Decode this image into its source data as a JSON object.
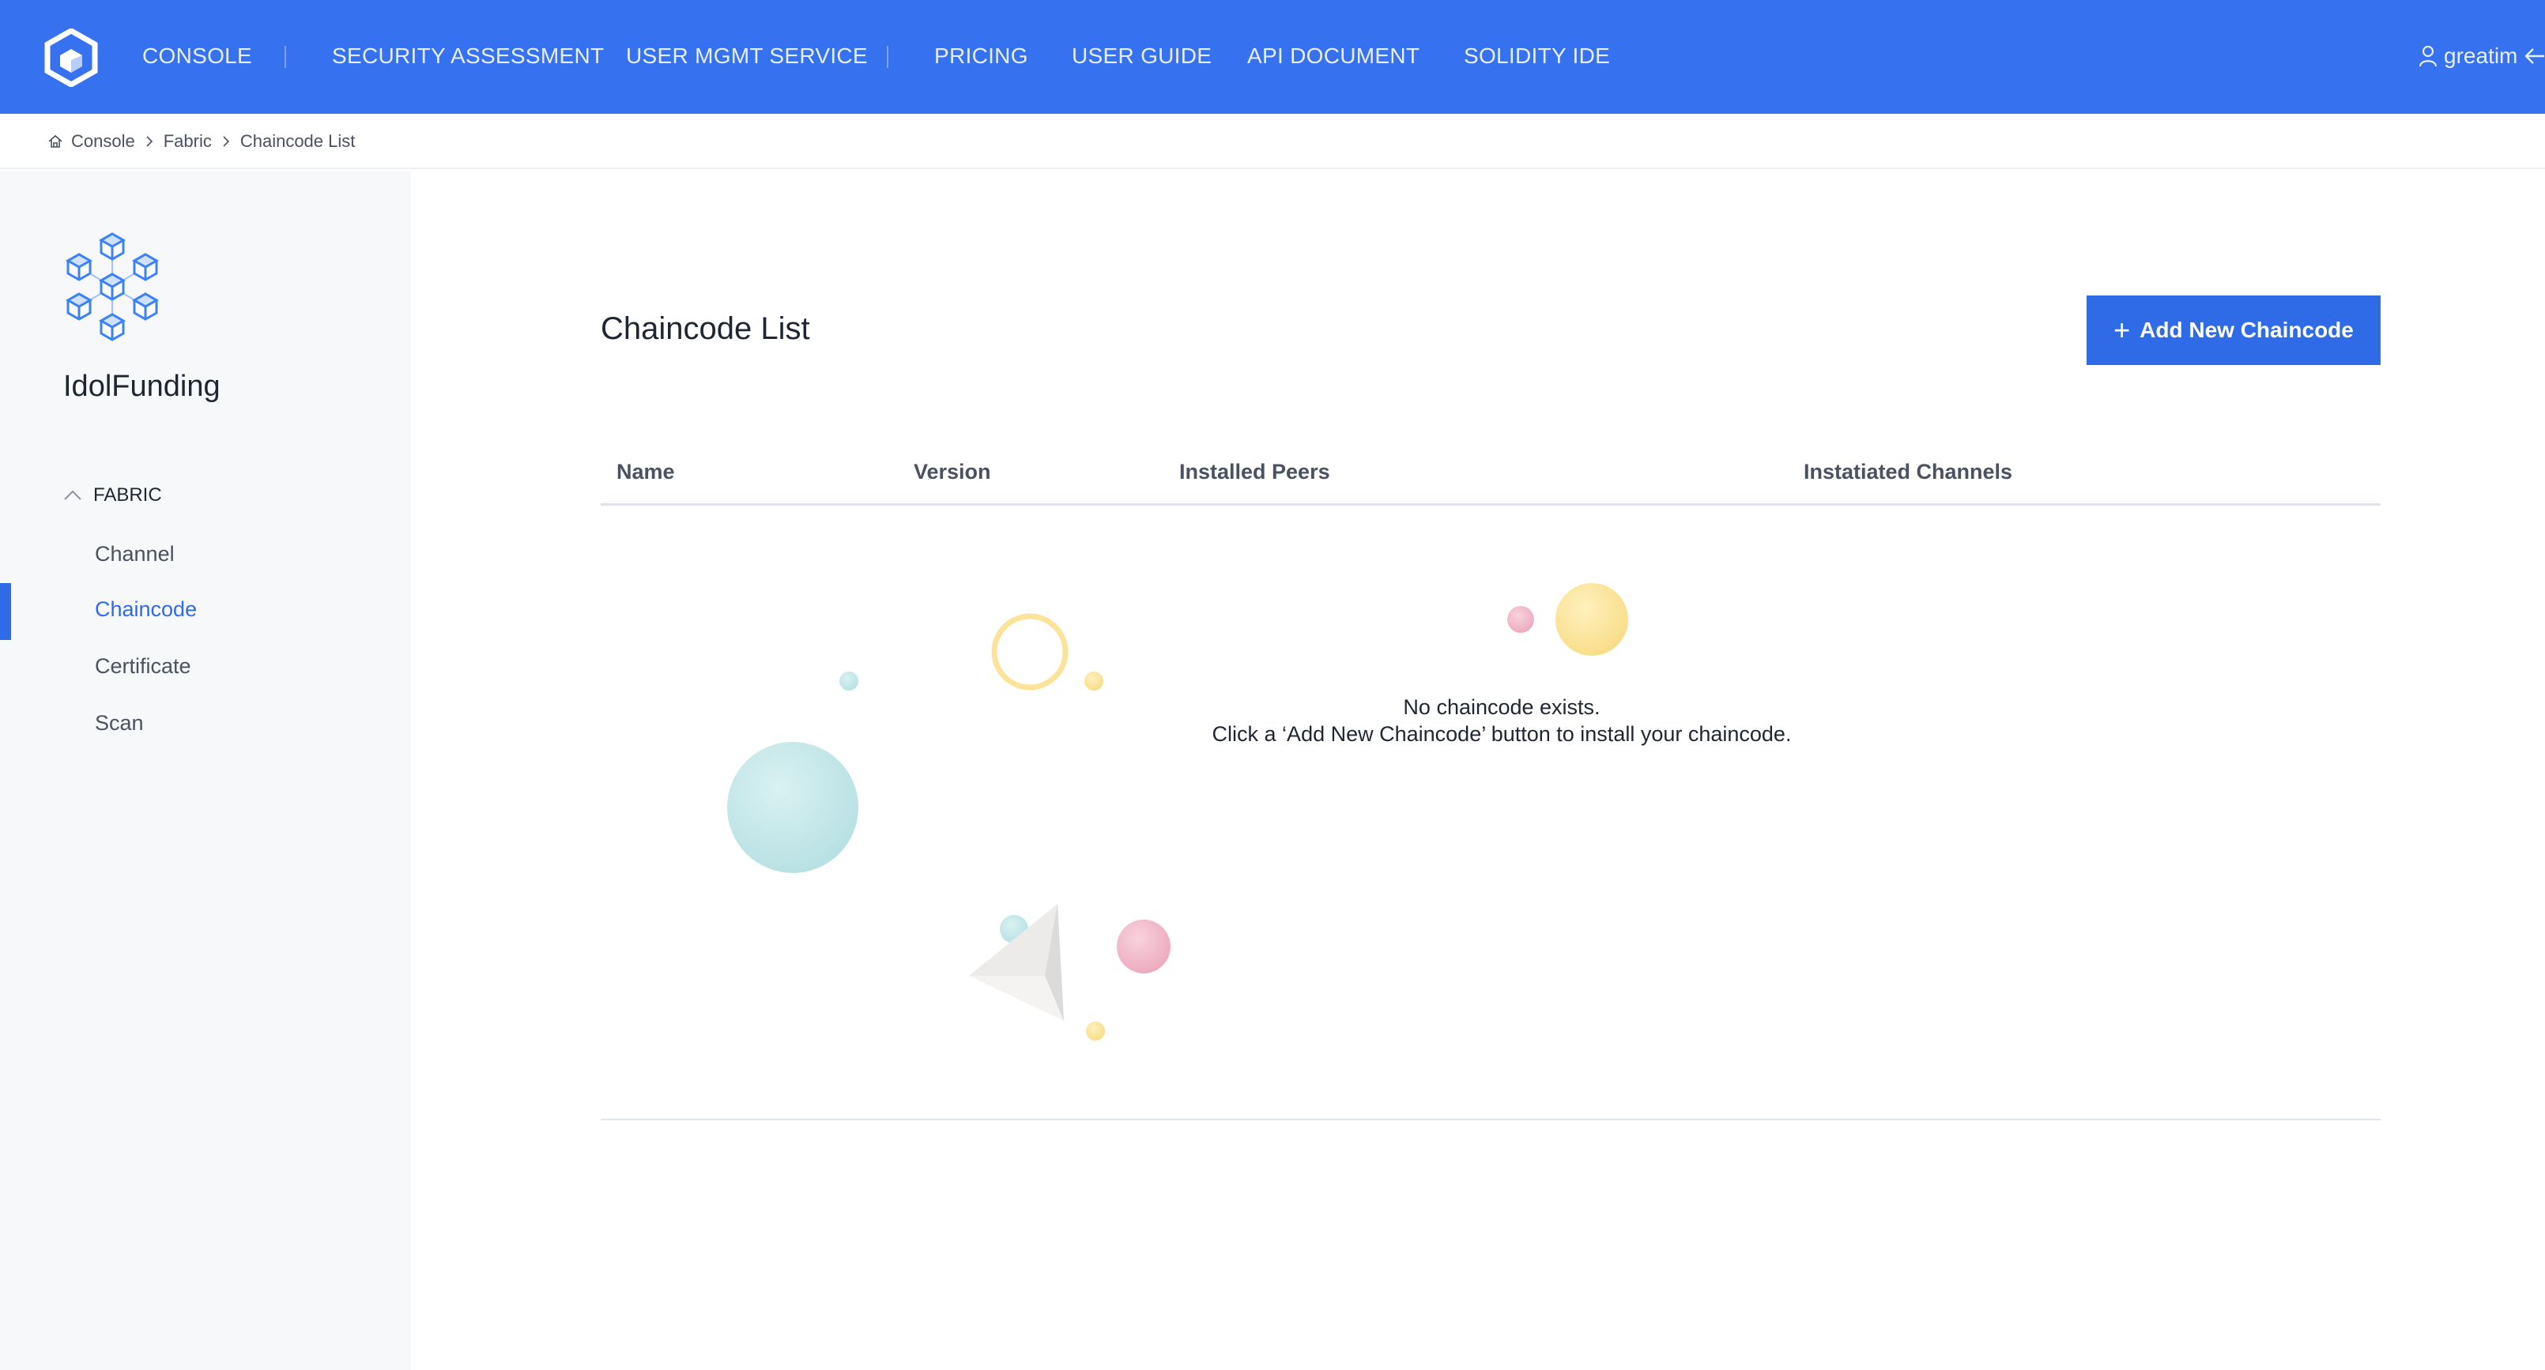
{
  "nav": {
    "items": [
      {
        "label": "CONSOLE"
      },
      {
        "label": "SECURITY ASSESSMENT"
      },
      {
        "label": "USER MGMT SERVICE"
      },
      {
        "label": "PRICING"
      },
      {
        "label": "USER GUIDE"
      },
      {
        "label": "API DOCUMENT"
      },
      {
        "label": "SOLIDITY IDE"
      }
    ],
    "user": {
      "name": "greatim",
      "icon": "user-icon",
      "logout_icon": "logout-arrow-icon"
    },
    "logo_icon": "platform-logo-icon"
  },
  "breadcrumb": {
    "home_icon": "home-icon",
    "items": [
      "Console",
      "Fabric",
      "Chaincode List"
    ]
  },
  "sidebar": {
    "project_icon": "blockchain-cubes-icon",
    "project_name": "IdolFunding",
    "section": {
      "label": "FABRIC",
      "state": "expanded"
    },
    "items": [
      {
        "label": "Channel"
      },
      {
        "label": "Chaincode",
        "active": true
      },
      {
        "label": "Certificate"
      },
      {
        "label": "Scan"
      }
    ]
  },
  "main": {
    "title": "Chaincode List",
    "add_button_label": "Add New Chaincode",
    "table": {
      "columns": [
        "Name",
        "Version",
        "Installed Peers",
        "Instatiated Channels"
      ],
      "rows": []
    },
    "empty_state": {
      "line1": "No chaincode exists.",
      "line2": "Click a ‘Add New Chaincode’ button to install your chaincode."
    }
  },
  "colors": {
    "primary": "#3671f0",
    "accent": "#2f6be7",
    "sidebar_bg": "#f7f8fa",
    "bubble_teal": "#bfe6e8",
    "bubble_yellow": "#fbe39a",
    "bubble_pink": "#f2b8c8"
  }
}
